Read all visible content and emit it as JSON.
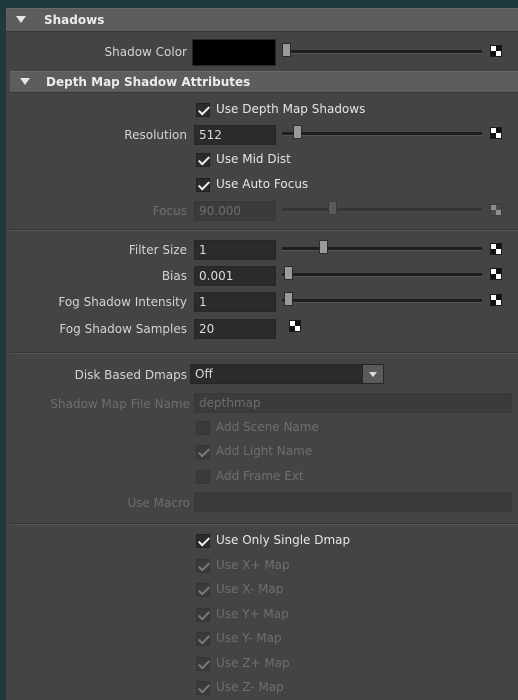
{
  "shadows": {
    "title": "Shadows",
    "shadow_color_label": "Shadow Color",
    "shadow_color_value": "#000000"
  },
  "depth_map": {
    "title": "Depth Map Shadow Attributes",
    "use_depth_map_shadows": "Use Depth Map Shadows",
    "resolution_label": "Resolution",
    "resolution_value": "512",
    "use_mid_dist": "Use Mid Dist",
    "use_auto_focus": "Use Auto Focus",
    "focus_label": "Focus",
    "focus_value": "90.000",
    "filter_size_label": "Filter Size",
    "filter_size_value": "1",
    "bias_label": "Bias",
    "bias_value": "0.001",
    "fog_shadow_intensity_label": "Fog Shadow Intensity",
    "fog_shadow_intensity_value": "1",
    "fog_shadow_samples_label": "Fog Shadow Samples",
    "fog_shadow_samples_value": "20",
    "disk_based_dmaps_label": "Disk Based Dmaps",
    "disk_based_dmaps_value": "Off",
    "shadow_map_file_name_label": "Shadow Map File Name",
    "shadow_map_file_name_value": "depthmap",
    "add_scene_name": "Add Scene Name",
    "add_light_name": "Add Light Name",
    "add_frame_ext": "Add Frame Ext",
    "use_macro_label": "Use Macro",
    "use_only_single_dmap": "Use Only Single Dmap",
    "use_x_plus_map": "Use X+ Map",
    "use_x_minus_map": "Use X- Map",
    "use_y_plus_map": "Use Y+ Map",
    "use_y_minus_map": "Use Y- Map",
    "use_z_plus_map": "Use Z+ Map",
    "use_z_minus_map": "Use Z- Map"
  },
  "icons": {
    "section_toggle": "triangle-down-icon",
    "map_button": "checker-map-icon",
    "checkbox_checked": "checkmark-icon",
    "dropdown_arrow": "chevron-down-icon"
  },
  "colors": {
    "panel_bg": "#444444",
    "header_bg": "#5d5d5d",
    "field_bg": "#2b2b2b",
    "frame_bg": "#1e3a3e"
  }
}
